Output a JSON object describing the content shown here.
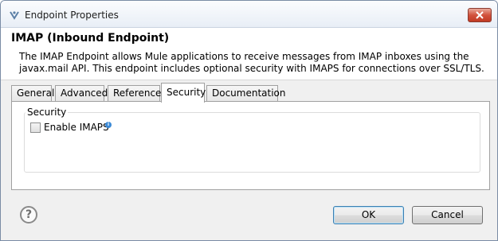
{
  "window": {
    "title": "Endpoint Properties",
    "icon": "mule-app-icon",
    "close_icon": "close-icon"
  },
  "header": {
    "heading": "IMAP (Inbound Endpoint)",
    "description": "The IMAP Endpoint allows Mule applications to receive messages from IMAP inboxes using the javax.mail API. This endpoint includes optional security with IMAPS for connections over SSL/TLS."
  },
  "tabs": [
    {
      "label": "General",
      "active": false
    },
    {
      "label": "Advanced",
      "active": false
    },
    {
      "label": "References",
      "active": false
    },
    {
      "label": "Security",
      "active": true
    },
    {
      "label": "Documentation",
      "active": false
    }
  ],
  "security": {
    "group_label": "Security",
    "enable_imaps_label": "Enable IMAPS",
    "enable_imaps_checked": false,
    "info_icon": "info-icon"
  },
  "footer": {
    "help_icon": "help-icon",
    "ok_label": "OK",
    "cancel_label": "Cancel"
  }
}
